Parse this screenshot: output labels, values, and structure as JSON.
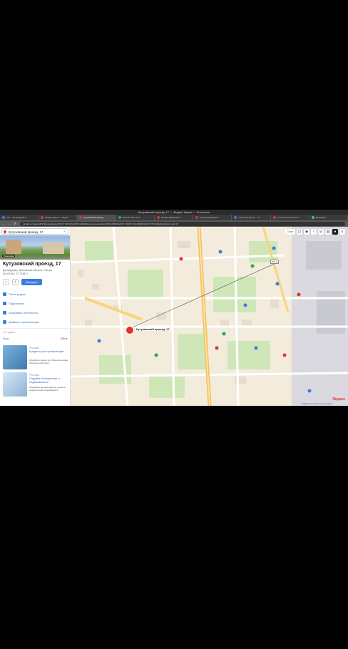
{
  "window": {
    "title": "Кутузовский проезд, 17 — Яндекс Карты — Chromium"
  },
  "tabs": [
    {
      "label": "471 – Загородный м",
      "color": "#3b7ddd",
      "active": false
    },
    {
      "label": "Яндекс карты — Яндек",
      "color": "#e5312e",
      "active": false
    },
    {
      "label": "Кутузовский проезд,",
      "color": "#e5312e",
      "active": true
    },
    {
      "label": "Фильмы 2Гиг в Ал",
      "color": "#2ea44f",
      "active": false
    },
    {
      "label": "Яндекс Вредительн",
      "color": "#e5312e",
      "active": false
    },
    {
      "label": "Леонид наблюдает",
      "color": "#e5312e",
      "active": false
    },
    {
      "label": "Стать мастером — Пт",
      "color": "#3b7ddd",
      "active": false
    },
    {
      "label": "Статьи мастера 61 из",
      "color": "#e5312e",
      "active": false
    },
    {
      "label": "WhatsApp",
      "color": "#25d366",
      "active": false
    }
  ],
  "addressbar": {
    "url": "yandex.ru/maps/10725/domodedovo/?ll=37.747346%2C55.434532&mode=routes&rtext=55.431864%2C37.743817~55.435946%2C37.753216&rtt=pd&ruri=~&z=17",
    "back_icon": "←",
    "forward_icon": "→",
    "reload_icon": "⟳"
  },
  "sidebar": {
    "search_value": "Кутузовский проезд, 17",
    "photo_badge": "Панорама",
    "place_title": "Кутузовский проезд, 17",
    "address": "Домодедово, Московская область, Россия",
    "coords": "55.431864, 37.743817",
    "route_label": "Маршрут",
    "menu": [
      {
        "label": "Поиск рядом",
        "icon": "search-icon"
      },
      {
        "label": "Поделиться",
        "icon": "share-icon"
      },
      {
        "label": "Исправить неточность",
        "icon": "edit-icon"
      },
      {
        "label": "Добавить организацию",
        "icon": "add-icon"
      }
    ],
    "nearby_label": "Что рядом",
    "entrance_label": "Вход",
    "entrance_distance": "200 м",
    "ads": [
      {
        "source": "Реклама",
        "title": "Кредиты для организаций",
        "text": "Оформите кредит для бизнеса онлайн. Решение за 5 минут."
      },
      {
        "source": "Реклама",
        "title": "Подайте объявление о недвижимости",
        "text": "Продажа и аренда квартир, домов и коммерческой недвижимости."
      }
    ]
  },
  "map": {
    "marker_label": "Кутузовский проезд, 17",
    "route_distance": "700 м",
    "layers_label": "Слои",
    "copyright": "© Яндекс Условия использования",
    "logo": "Яндекс"
  }
}
